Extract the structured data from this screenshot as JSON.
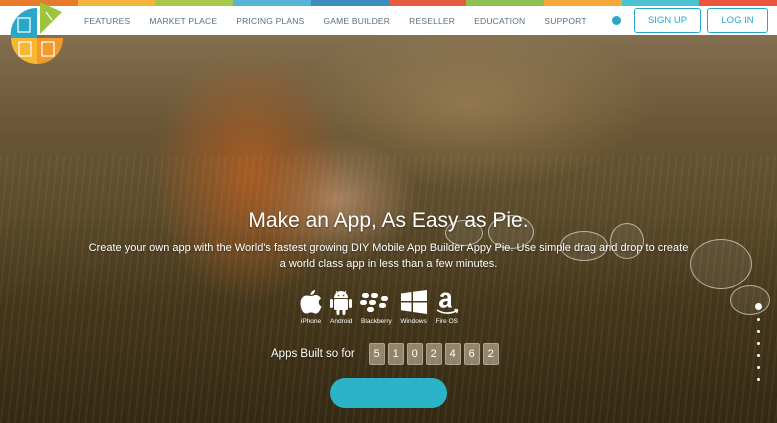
{
  "brand": {
    "stripe_colors": [
      "#e77a2b",
      "#f3b53a",
      "#a7c84a",
      "#56b4d8",
      "#3c8dbd",
      "#e65b3f",
      "#8cc152",
      "#f7a738",
      "#4ec2d5",
      "#e9573f"
    ],
    "logo_colors": [
      "#2aa7c9",
      "#f29a2e",
      "#9bc53d"
    ]
  },
  "nav": {
    "items": [
      "FEATURES",
      "MARKET PLACE",
      "PRICING PLANS",
      "GAME BUILDER",
      "RESELLER",
      "EDUCATION",
      "SUPPORT"
    ],
    "signup": "SIGN UP",
    "login": "LOG IN"
  },
  "hero": {
    "headline": "Make an App, As Easy as Pie.",
    "subtext": "Create your own app with the World's fastest growing DIY Mobile App Builder Appy Pie. Use simple drag and drop to create a world class app in less than a few minutes.",
    "platforms": [
      {
        "label": "iPhone",
        "icon": "apple-icon"
      },
      {
        "label": "Android",
        "icon": "android-icon"
      },
      {
        "label": "Blackberry",
        "icon": "blackberry-icon"
      },
      {
        "label": "Windows",
        "icon": "windows-icon"
      },
      {
        "label": "Fire OS",
        "icon": "amazon-icon"
      }
    ],
    "counter_label": "Apps Built so for",
    "digits": [
      "5",
      "1",
      "0",
      "2",
      "4",
      "6",
      "2"
    ],
    "accent": "#2bb3c8"
  },
  "slider": {
    "slide_count": 7,
    "active_index": 0
  }
}
